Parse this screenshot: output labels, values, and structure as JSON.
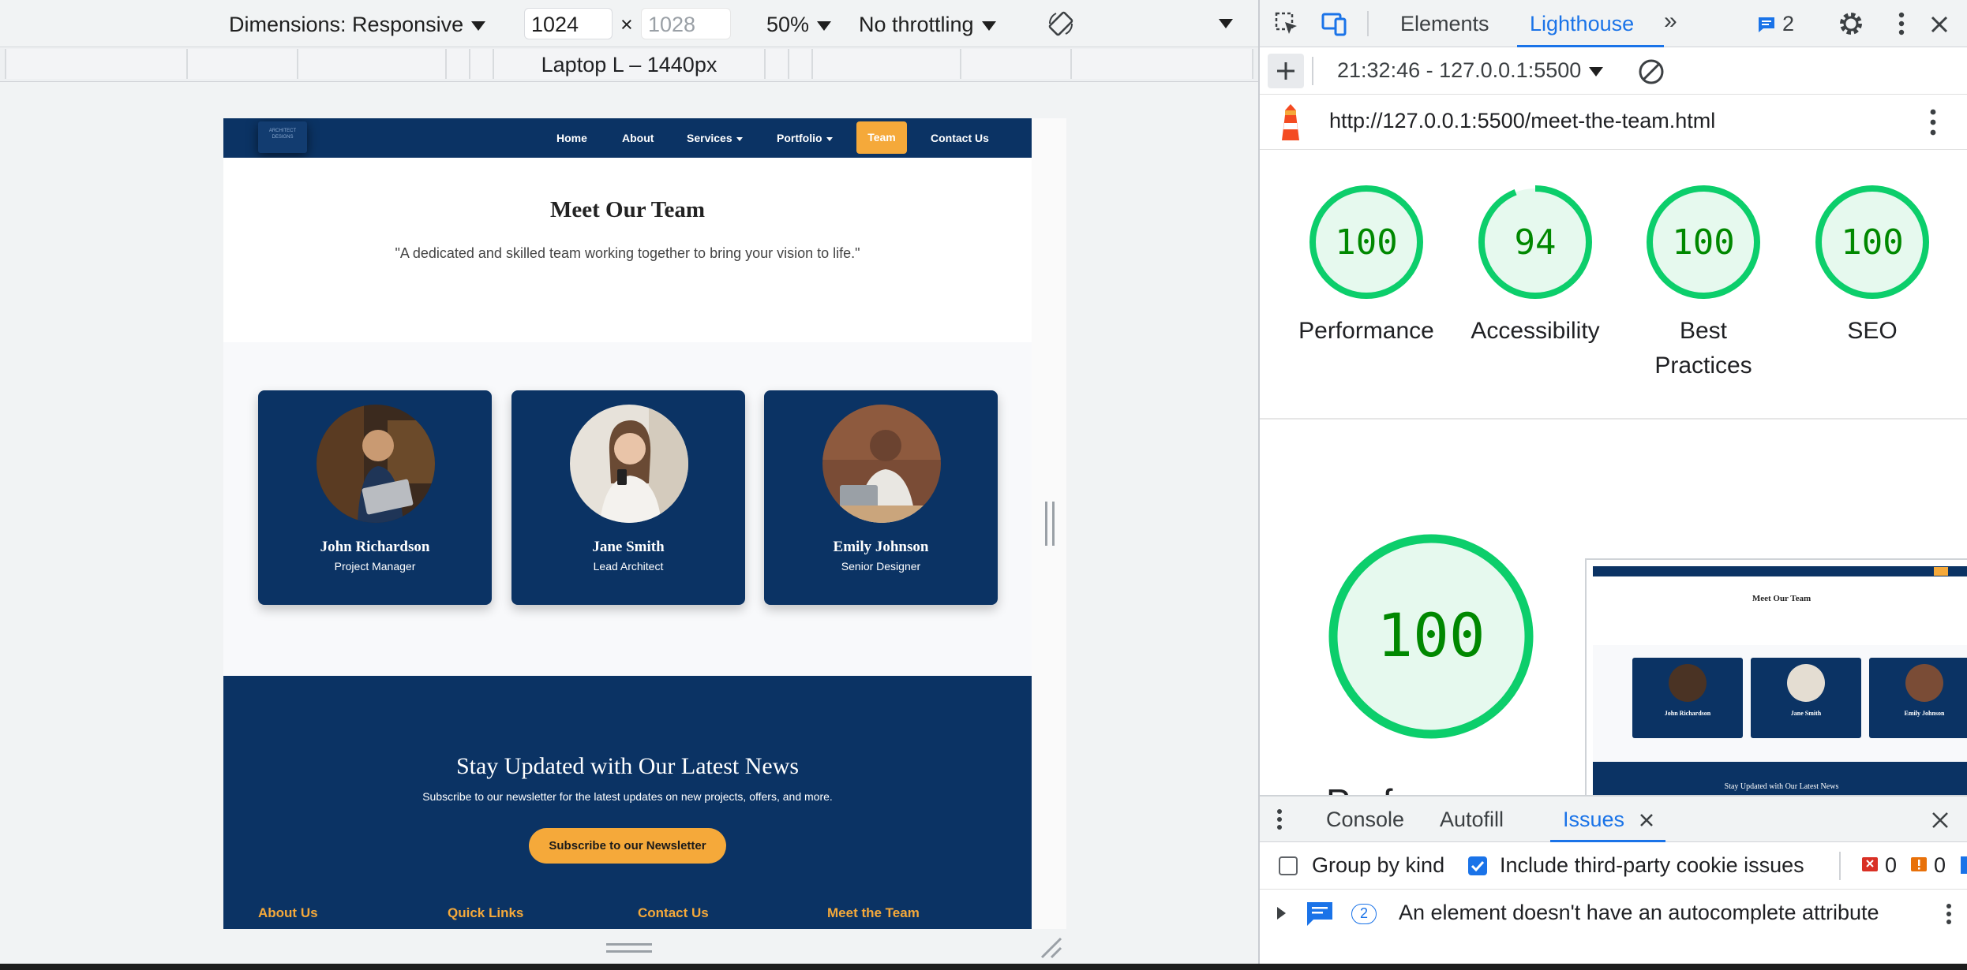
{
  "device_toolbar": {
    "dimensions_label": "Dimensions: Responsive",
    "width_value": "1024",
    "times": "×",
    "height_value": "1028",
    "zoom": "50%",
    "throttling": "No throttling",
    "media_query_label": "Laptop L – 1440px"
  },
  "page": {
    "logo_text": "ARCHITECT DESIGNS",
    "nav": {
      "home": "Home",
      "about": "About",
      "services": "Services",
      "portfolio": "Portfolio",
      "team": "Team",
      "contact": "Contact Us"
    },
    "hero": {
      "title": "Meet Our Team",
      "tagline": "\"A dedicated and skilled team working together to bring your vision to life.\""
    },
    "team": [
      {
        "name": "John Richardson",
        "role": "Project Manager"
      },
      {
        "name": "Jane Smith",
        "role": "Lead Architect"
      },
      {
        "name": "Emily Johnson",
        "role": "Senior Designer"
      }
    ],
    "newsletter": {
      "title": "Stay Updated with Our Latest News",
      "text": "Subscribe to our newsletter for the latest updates on new projects, offers, and more.",
      "button": "Subscribe to our Newsletter"
    },
    "footer_headings": [
      "About Us",
      "Quick Links",
      "Contact Us",
      "Meet the Team"
    ]
  },
  "devtools": {
    "tabs": {
      "elements": "Elements",
      "lighthouse": "Lighthouse"
    },
    "issues_badge": "2",
    "run_label": "21:32:46 - 127.0.0.1:5500",
    "url": "http://127.0.0.1:5500/meet-the-team.html",
    "scores": [
      {
        "value": 100,
        "label_line1": "Performance",
        "label_line2": ""
      },
      {
        "value": 94,
        "label_line1": "Accessibility",
        "label_line2": ""
      },
      {
        "value": 100,
        "label_line1": "Best",
        "label_line2": "Practices"
      },
      {
        "value": 100,
        "label_line1": "SEO",
        "label_line2": ""
      }
    ],
    "big_score": 100,
    "big_label_partial": "Perf",
    "thumbnail": {
      "title": "Meet Our Team",
      "names": [
        "John Richardson",
        "Jane Smith",
        "Emily Johnson"
      ],
      "newsletter": "Stay Updated with Our Latest News"
    },
    "drawer": {
      "console": "Console",
      "autofill": "Autofill",
      "issues": "Issues",
      "group_by_kind": "Group by kind",
      "include_third_party": "Include third-party cookie issues",
      "error_count": "0",
      "warning_count": "0",
      "issue_count": "2",
      "issue_text": "An element doesn't have an autocomplete attribute"
    },
    "colors": {
      "pass": "#0cce6b",
      "pass_text": "#008800",
      "pass_fill": "#e6f9ee",
      "accent": "#1a73e8"
    }
  }
}
